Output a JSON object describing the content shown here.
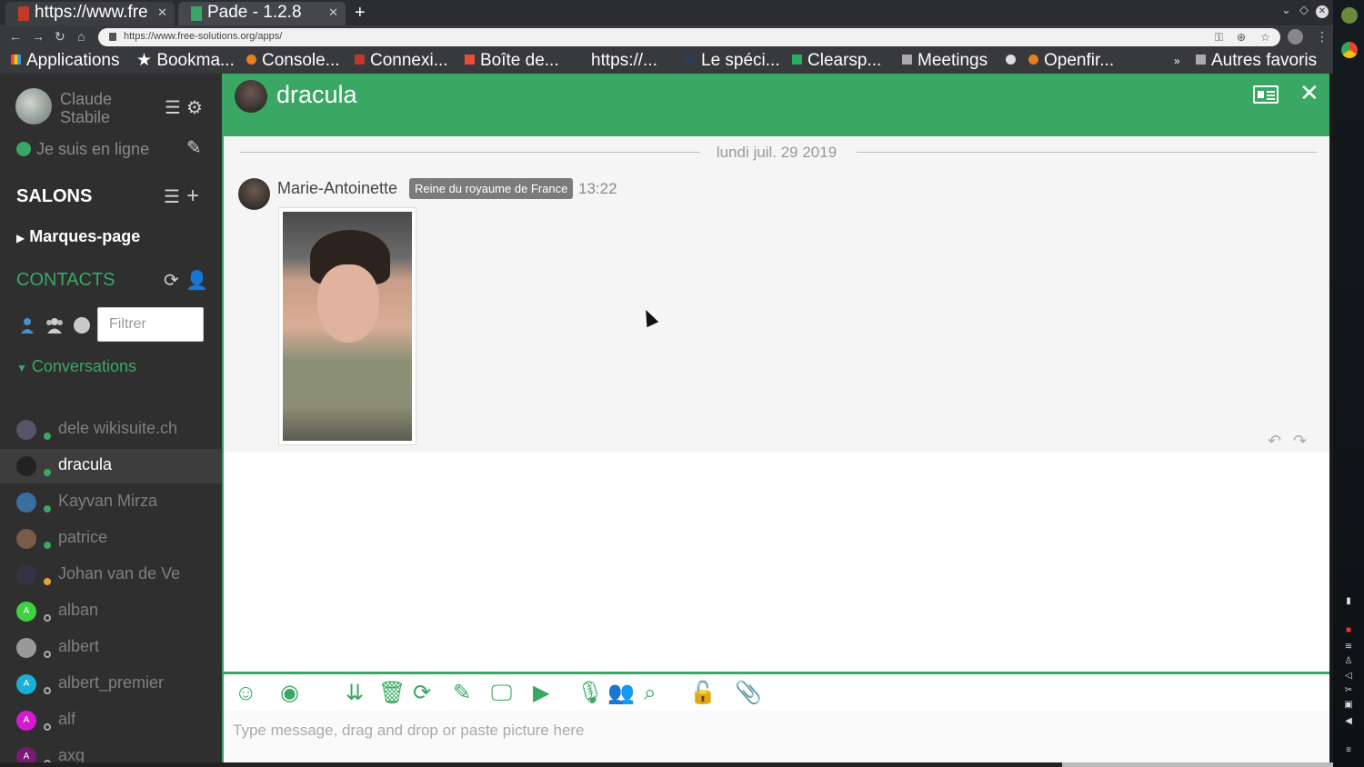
{
  "browser": {
    "tabs": [
      {
        "title": "https://www.fre",
        "active": false
      },
      {
        "title": "Pade - 1.2.8",
        "active": true
      }
    ],
    "url": "https://www.free-solutions.org/apps/",
    "bookmarks": [
      "Applications",
      "Bookma...",
      "Console...",
      "Connexi...",
      "Boîte de...",
      "https://...",
      "Le spéci...",
      "Clearsp...",
      "Meetings",
      "Openfir..."
    ],
    "bookmarks_more": "»",
    "bookmarks_other": "Autres favoris"
  },
  "sidebar": {
    "user": {
      "first": "Claude",
      "last": "Stabile"
    },
    "status": "Je suis en ligne",
    "rooms_title": "SALONS",
    "bookmarks_label": "Marques-page",
    "contacts_title": "CONTACTS",
    "filter_placeholder": "Filtrer",
    "conversations_label": "Conversations",
    "contacts": [
      {
        "name": "dele wikisuite.ch",
        "status": "online",
        "initial": "",
        "color": "#556"
      },
      {
        "name": "dracula",
        "status": "online",
        "initial": "",
        "color": "#222",
        "selected": true
      },
      {
        "name": "Kayvan Mirza",
        "status": "online",
        "initial": "",
        "color": "#3a6fa0"
      },
      {
        "name": "patrice",
        "status": "online",
        "initial": "",
        "color": "#7a5a4a"
      },
      {
        "name": "Johan van de Ve",
        "status": "away",
        "initial": "",
        "color": "#334"
      },
      {
        "name": "alban",
        "status": "offline",
        "initial": "A",
        "color": "#3fd13f"
      },
      {
        "name": "albert",
        "status": "offline",
        "initial": "",
        "color": "#999"
      },
      {
        "name": "albert_premier",
        "status": "offline",
        "initial": "A",
        "color": "#1ab0d6"
      },
      {
        "name": "alf",
        "status": "offline",
        "initial": "A",
        "color": "#d51ad0"
      },
      {
        "name": "axg",
        "status": "offline",
        "initial": "A",
        "color": "#7a1a70"
      }
    ]
  },
  "chat": {
    "title": "dracula",
    "day": "lundi juil. 29 2019",
    "message": {
      "author": "Marie-Antoinette",
      "role": "Reine du royaume de France",
      "time": "13:22"
    },
    "input_placeholder": "Type message, drag and drop or paste picture here"
  },
  "colors": {
    "accent": "#3aa864",
    "sidebar_bg": "#2f2f2f"
  }
}
